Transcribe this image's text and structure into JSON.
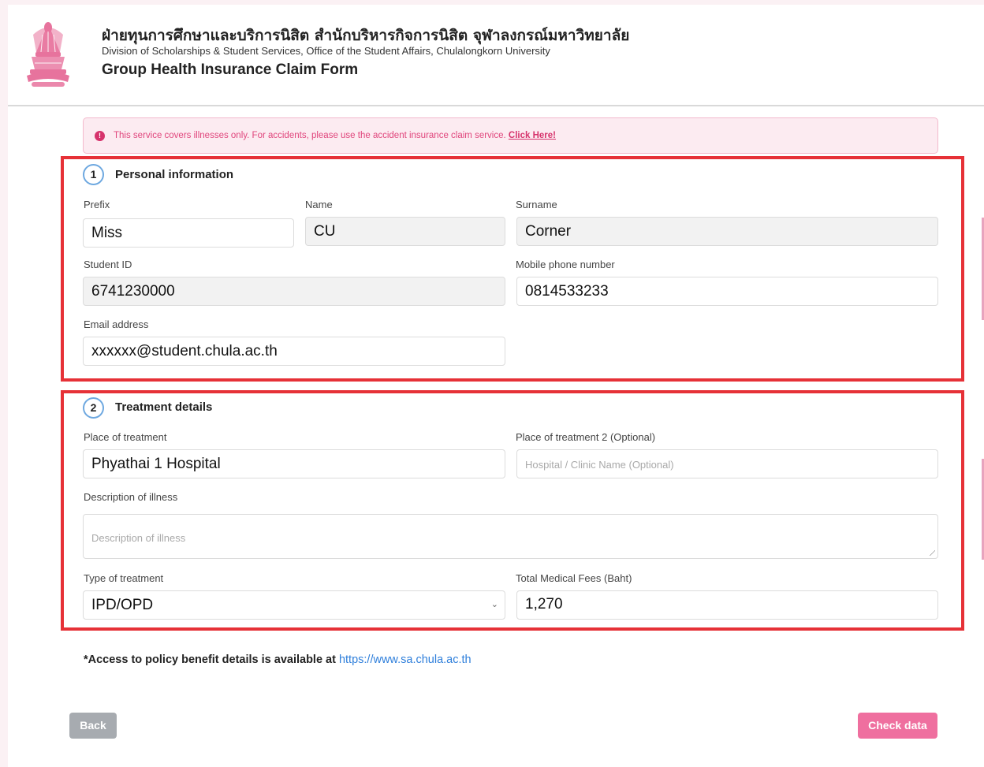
{
  "header": {
    "title_thai": "ฝ่ายทุนการศึกษาและบริการนิสิต สำนักบริหารกิจการนิสิต จุฬาลงกรณ์มหาวิทยาลัย",
    "title_eng": "Division of Scholarships & Student Services, Office of the Student Affairs, Chulalongkorn University",
    "form_title": "Group Health Insurance Claim Form",
    "logo_icon": "chula-crest-icon"
  },
  "notice": {
    "icon": "info-icon",
    "icon_glyph": "!",
    "text": "This service covers illnesses only. For accidents, please use the accident insurance claim service.",
    "link_label": "Click Here!"
  },
  "personal": {
    "step": "1",
    "title": "Personal information",
    "prefix_label": "Prefix",
    "prefix_value": "Miss",
    "name_label": "Name",
    "name_value": "CU",
    "surname_label": "Surname",
    "surname_value": "Corner",
    "student_id_label": "Student ID",
    "student_id_value": "6741230000",
    "phone_label": "Mobile phone number",
    "phone_value": "0814533233",
    "email_label": "Email address",
    "email_value": "xxxxxx@student.chula.ac.th"
  },
  "treatment": {
    "step": "2",
    "title": "Treatment details",
    "place_label": "Place of treatment",
    "place_value": "Phyathai 1 Hospital",
    "place2_label": "Place of treatment 2 (Optional)",
    "place2_placeholder": "Hospital / Clinic Name (Optional)",
    "description_label": "Description of illness",
    "description_placeholder": "Description of illness",
    "type_label": "Type of treatment",
    "type_value": "IPD/OPD",
    "fees_label": "Total Medical Fees (Baht)",
    "fees_value": "1,270"
  },
  "policy": {
    "text": "*Access to policy benefit details is available at ",
    "link": "https://www.sa.chula.ac.th"
  },
  "buttons": {
    "back_label": "Back",
    "check_label": "Check data"
  },
  "colors": {
    "accent_pink": "#ef6f9f",
    "highlight_red": "#e63137",
    "link_blue": "#2f7fdb"
  }
}
